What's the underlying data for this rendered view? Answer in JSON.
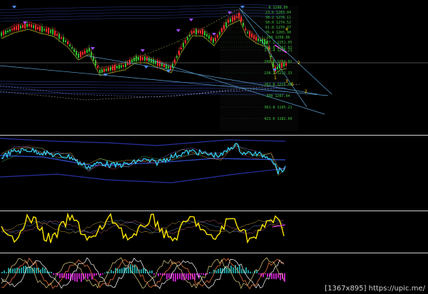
{
  "footer": {
    "size_text": "[1367x895]",
    "site_text": "https://upic.me/"
  },
  "price_panel": {
    "fib_labels": [
      "0 1290.00",
      "23.6 1283.04",
      "38.2 1278.11",
      "50.0 1274.52",
      "61.8 1270.37",
      "76.4 1265.90",
      "100 1258.06",
      "127.2 1251.05",
      "161.8 1242.61",
      "176.4 1236.21",
      "200.0 1231.02",
      "238.2 1222.33",
      "261.8 1215.00",
      "300 1207.04",
      "361.8 1195.21",
      "423.6 1182.60"
    ],
    "wave_labels": [
      "4",
      "2",
      "1",
      "3",
      "5",
      "2"
    ]
  },
  "colors": {
    "background": "#000000",
    "bull_candle": "#2fbf2f",
    "bear_candle": "#ff2a2a",
    "fractal_up": "#a04cff",
    "fractal_down": "#4c8cff",
    "fib_text": "#3fbf3f",
    "trendline": "#5aa0d0",
    "oscillator_main": "#33d6ff",
    "cci_line": "#ffe600",
    "histogram": "#c020c0"
  },
  "indicators": [
    "price-candles",
    "envelope-bands",
    "cyan-oscillator",
    "yellow-cci",
    "macd-histogram"
  ]
}
